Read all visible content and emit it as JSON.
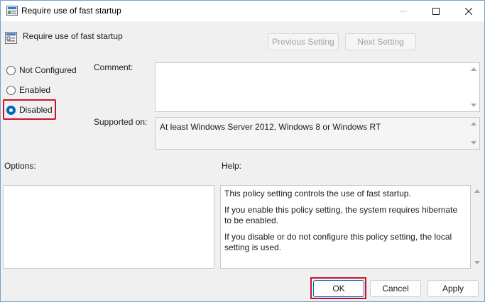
{
  "window": {
    "title": "Require use of fast startup"
  },
  "header": {
    "title": "Require use of fast startup",
    "prev_label": "Previous Setting",
    "next_label": "Next Setting"
  },
  "state": {
    "options": [
      {
        "label": "Not Configured",
        "checked": false
      },
      {
        "label": "Enabled",
        "checked": false
      },
      {
        "label": "Disabled",
        "checked": true
      }
    ]
  },
  "comment": {
    "label": "Comment:",
    "value": ""
  },
  "supported": {
    "label": "Supported on:",
    "value": "At least Windows Server 2012, Windows 8 or Windows RT"
  },
  "options_panel": {
    "label": "Options:"
  },
  "help": {
    "label": "Help:",
    "paragraphs": [
      "This policy setting controls the use of fast startup.",
      "If you enable this policy setting, the system requires hibernate to be enabled.",
      "If you disable or do not configure this policy setting, the local setting is used."
    ]
  },
  "buttons": {
    "ok": "OK",
    "cancel": "Cancel",
    "apply": "Apply"
  },
  "colors": {
    "accent": "#0067c0",
    "highlight": "#d0112b"
  }
}
